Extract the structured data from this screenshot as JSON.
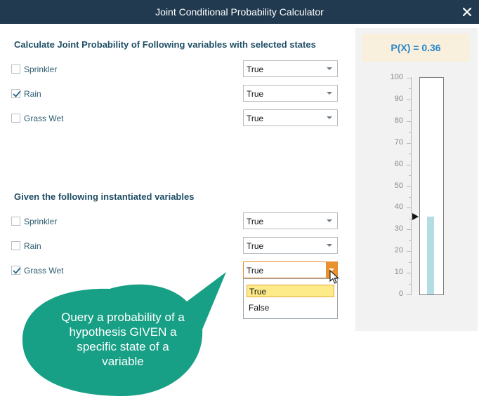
{
  "window": {
    "title": "Joint Conditional Probability Calculator",
    "close_icon": "close-icon"
  },
  "joint": {
    "heading": "Calculate Joint Probability of Following variables with selected states",
    "items": [
      {
        "label": "Sprinkler",
        "checked": false,
        "state": "True"
      },
      {
        "label": "Rain",
        "checked": true,
        "state": "True"
      },
      {
        "label": "Grass Wet",
        "checked": false,
        "state": "True"
      }
    ]
  },
  "given": {
    "heading": "Given the following instantiated variables",
    "items": [
      {
        "label": "Sprinkler",
        "checked": false,
        "state": "True"
      },
      {
        "label": "Rain",
        "checked": false,
        "state": "True"
      },
      {
        "label": "Grass Wet",
        "checked": true,
        "state": "True"
      }
    ],
    "dropdown": {
      "options": [
        "True",
        "False"
      ],
      "highlighted": "True"
    }
  },
  "result": {
    "label": "P(X) = 0.36",
    "value": 0.36,
    "axis_ticks": [
      "100",
      "90",
      "80",
      "70",
      "60",
      "50",
      "40",
      "30",
      "20",
      "10",
      "0"
    ]
  },
  "callout": {
    "text": "Query a probability of a hypothesis GIVEN a specific state of a variable"
  },
  "colors": {
    "titlebar": "#213a50",
    "heading": "#1f4e66",
    "label": "#2b5c70",
    "accent_orange": "#e8922f",
    "value_blue": "#2b86c8",
    "gauge_fill": "#b4dde3",
    "callout_green": "#17a086"
  }
}
